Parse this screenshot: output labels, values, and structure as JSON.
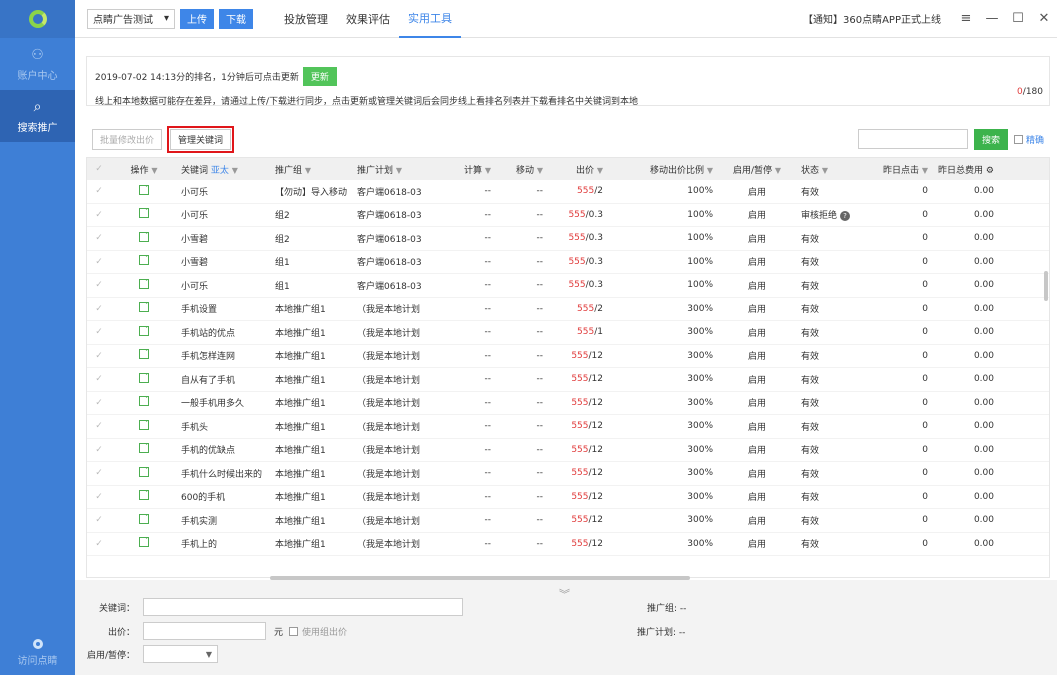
{
  "sidebar": {
    "items": [
      {
        "label": "账户中心",
        "icon": "account-icon"
      },
      {
        "label": "搜索推广",
        "icon": "search-promo-icon"
      }
    ],
    "bottom_label": "访问点睛"
  },
  "topbar": {
    "account": "点睛广告测试",
    "upload": "上传",
    "download": "下载",
    "nav": [
      "投放管理",
      "效果评估",
      "实用工具"
    ],
    "active_nav": "实用工具",
    "notice": "【通知】360点睛APP正式上线",
    "window_controls": [
      "≡",
      "—",
      "☐",
      "✕"
    ]
  },
  "info": {
    "line1": "2019-07-02 14:13分的排名，1分钟后可点击更新",
    "update_btn": "更新",
    "line2": "线上和本地数据可能存在差异，请通过上传/下载进行同步，点击更新或管理关键词后会同步线上看排名列表并下载看排名中关键词到本地",
    "count_used": "0",
    "count_total": "/180"
  },
  "toolbar": {
    "bulk_price": "批量修改出价",
    "manage_keywords": "管理关键词",
    "search_btn": "搜索",
    "exact": "精确"
  },
  "table": {
    "headers": [
      "操作",
      "关键词",
      "推广组",
      "推广计划",
      "计算",
      "移动",
      "出价",
      "移动出价比例",
      "启用/暂停",
      "状态",
      "昨日点击",
      "昨日总费用"
    ],
    "keyword_filter": "亚太",
    "rows": [
      {
        "kw": "小可乐",
        "group": "【勿动】导入移动",
        "plan": "客户端0618-03",
        "calc": "--",
        "mobile": "--",
        "bid": "555",
        "bid_suffix": "/2",
        "ratio": "100%",
        "enabled": "启用",
        "status": "有效",
        "clicks": "0",
        "cost": "0.00"
      },
      {
        "kw": "小可乐",
        "group": "组2",
        "plan": "客户端0618-03",
        "calc": "--",
        "mobile": "--",
        "bid": "555",
        "bid_suffix": "/0.3",
        "ratio": "100%",
        "enabled": "启用",
        "status": "审核拒绝",
        "clicks": "0",
        "cost": "0.00"
      },
      {
        "kw": "小雪碧",
        "group": "组2",
        "plan": "客户端0618-03",
        "calc": "--",
        "mobile": "--",
        "bid": "555",
        "bid_suffix": "/0.3",
        "ratio": "100%",
        "enabled": "启用",
        "status": "有效",
        "clicks": "0",
        "cost": "0.00"
      },
      {
        "kw": "小雪碧",
        "group": "组1",
        "plan": "客户端0618-03",
        "calc": "--",
        "mobile": "--",
        "bid": "555",
        "bid_suffix": "/0.3",
        "ratio": "100%",
        "enabled": "启用",
        "status": "有效",
        "clicks": "0",
        "cost": "0.00"
      },
      {
        "kw": "小可乐",
        "group": "组1",
        "plan": "客户端0618-03",
        "calc": "--",
        "mobile": "--",
        "bid": "555",
        "bid_suffix": "/0.3",
        "ratio": "100%",
        "enabled": "启用",
        "status": "有效",
        "clicks": "0",
        "cost": "0.00"
      },
      {
        "kw": "手机设置",
        "group": "本地推广组1",
        "plan": "（我是本地计划",
        "calc": "--",
        "mobile": "--",
        "bid": "555",
        "bid_suffix": "/2",
        "ratio": "300%",
        "enabled": "启用",
        "status": "有效",
        "clicks": "0",
        "cost": "0.00"
      },
      {
        "kw": "手机站的优点",
        "group": "本地推广组1",
        "plan": "（我是本地计划",
        "calc": "--",
        "mobile": "--",
        "bid": "555",
        "bid_suffix": "/1",
        "ratio": "300%",
        "enabled": "启用",
        "status": "有效",
        "clicks": "0",
        "cost": "0.00"
      },
      {
        "kw": "手机怎样连网",
        "group": "本地推广组1",
        "plan": "（我是本地计划",
        "calc": "--",
        "mobile": "--",
        "bid": "555",
        "bid_suffix": "/12",
        "ratio": "300%",
        "enabled": "启用",
        "status": "有效",
        "clicks": "0",
        "cost": "0.00"
      },
      {
        "kw": "自从有了手机",
        "group": "本地推广组1",
        "plan": "（我是本地计划",
        "calc": "--",
        "mobile": "--",
        "bid": "555",
        "bid_suffix": "/12",
        "ratio": "300%",
        "enabled": "启用",
        "status": "有效",
        "clicks": "0",
        "cost": "0.00"
      },
      {
        "kw": "一般手机用多久",
        "group": "本地推广组1",
        "plan": "（我是本地计划",
        "calc": "--",
        "mobile": "--",
        "bid": "555",
        "bid_suffix": "/12",
        "ratio": "300%",
        "enabled": "启用",
        "status": "有效",
        "clicks": "0",
        "cost": "0.00"
      },
      {
        "kw": "手机头",
        "group": "本地推广组1",
        "plan": "（我是本地计划",
        "calc": "--",
        "mobile": "--",
        "bid": "555",
        "bid_suffix": "/12",
        "ratio": "300%",
        "enabled": "启用",
        "status": "有效",
        "clicks": "0",
        "cost": "0.00"
      },
      {
        "kw": "手机的优缺点",
        "group": "本地推广组1",
        "plan": "（我是本地计划",
        "calc": "--",
        "mobile": "--",
        "bid": "555",
        "bid_suffix": "/12",
        "ratio": "300%",
        "enabled": "启用",
        "status": "有效",
        "clicks": "0",
        "cost": "0.00"
      },
      {
        "kw": "手机什么时候出来的",
        "group": "本地推广组1",
        "plan": "（我是本地计划",
        "calc": "--",
        "mobile": "--",
        "bid": "555",
        "bid_suffix": "/12",
        "ratio": "300%",
        "enabled": "启用",
        "status": "有效",
        "clicks": "0",
        "cost": "0.00"
      },
      {
        "kw": "600的手机",
        "group": "本地推广组1",
        "plan": "（我是本地计划",
        "calc": "--",
        "mobile": "--",
        "bid": "555",
        "bid_suffix": "/12",
        "ratio": "300%",
        "enabled": "启用",
        "status": "有效",
        "clicks": "0",
        "cost": "0.00"
      },
      {
        "kw": "手机实测",
        "group": "本地推广组1",
        "plan": "（我是本地计划",
        "calc": "--",
        "mobile": "--",
        "bid": "555",
        "bid_suffix": "/12",
        "ratio": "300%",
        "enabled": "启用",
        "status": "有效",
        "clicks": "0",
        "cost": "0.00"
      },
      {
        "kw": "手机上的",
        "group": "本地推广组1",
        "plan": "（我是本地计划",
        "calc": "--",
        "mobile": "--",
        "bid": "555",
        "bid_suffix": "/12",
        "ratio": "300%",
        "enabled": "启用",
        "status": "有效",
        "clicks": "0",
        "cost": "0.00"
      }
    ]
  },
  "bottom_form": {
    "keyword_label": "关键词：",
    "bid_label": "出价：",
    "unit": "元",
    "use_group_bid": "使用组出价",
    "enable_label": "启用/暂停：",
    "group_label": "推广组:",
    "group_value": "--",
    "plan_label": "推广计划:",
    "plan_value": "--"
  }
}
